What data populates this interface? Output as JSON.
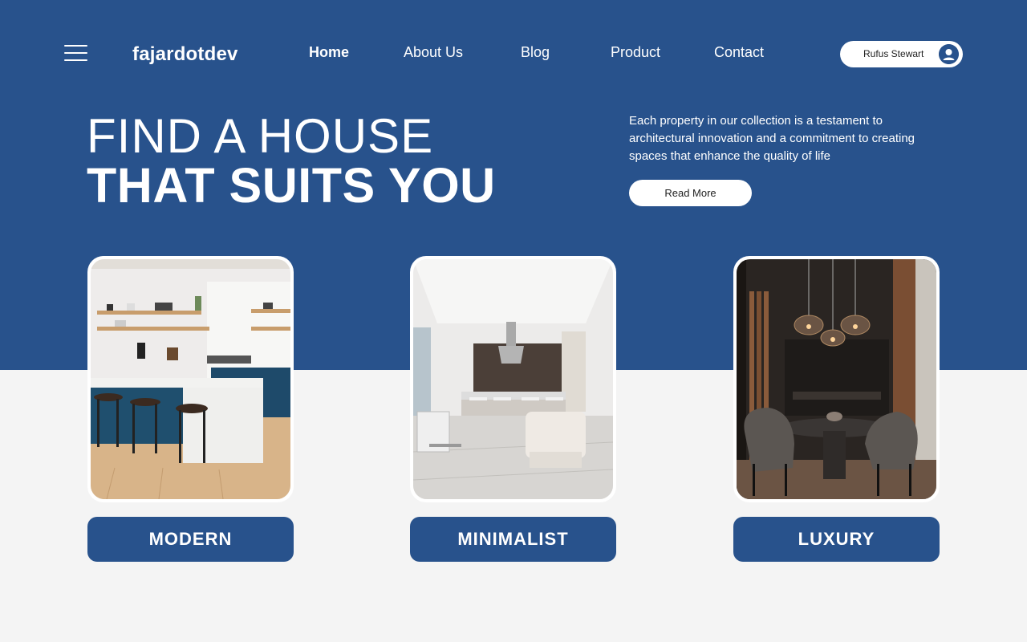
{
  "nav": {
    "logo": "fajardotdev",
    "links": [
      {
        "label": "Home"
      },
      {
        "label": "About Us"
      },
      {
        "label": "Blog"
      },
      {
        "label": "Product"
      },
      {
        "label": "Contact"
      }
    ],
    "user": {
      "name": "Rufus Stewart"
    }
  },
  "hero": {
    "line1": "FIND A HOUSE",
    "line2": "THAT SUITS YOU",
    "description": "Each property in our collection is a testament to architectural innovation and a commitment to creating spaces that enhance the quality of life",
    "cta_label": "Read More"
  },
  "categories": [
    {
      "label": "MODERN"
    },
    {
      "label": "MINIMALIST"
    },
    {
      "label": "LUXURY"
    }
  ],
  "colors": {
    "brand_blue": "#28528c",
    "page_background": "#f4f4f4",
    "white": "#ffffff"
  },
  "icons": {
    "menu": "hamburger-menu-icon",
    "user": "user-avatar-icon"
  }
}
